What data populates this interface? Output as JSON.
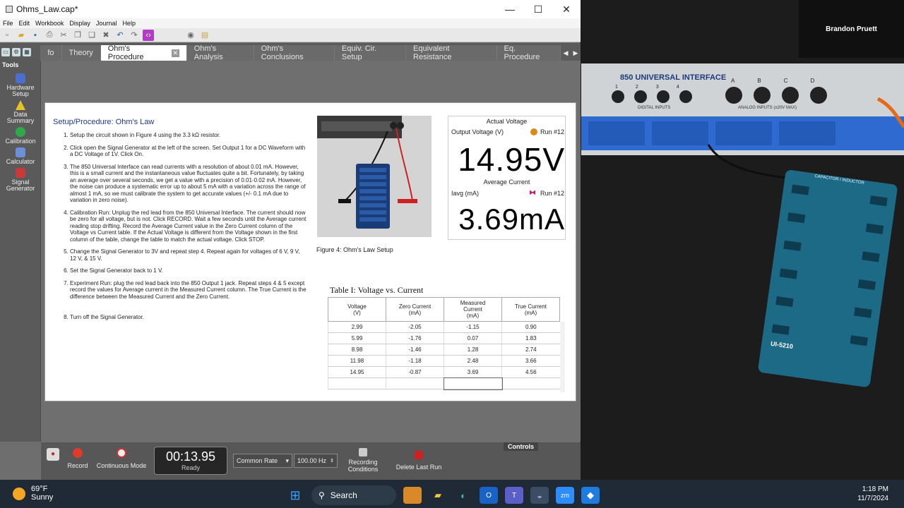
{
  "window": {
    "title": "Ohms_Law.cap*",
    "controls": {
      "minimize": "—",
      "maximize": "☐",
      "close": "✕"
    }
  },
  "menu": [
    "File",
    "Edit",
    "Workbook",
    "Display",
    "Journal",
    "Help"
  ],
  "tabs": [
    {
      "label": "fo",
      "active": false
    },
    {
      "label": "Theory",
      "active": false
    },
    {
      "label": "Ohm's Procedure",
      "active": true
    },
    {
      "label": "Ohm's Analysis",
      "active": false
    },
    {
      "label": "Ohm's Conclusions",
      "active": false
    },
    {
      "label": "Equiv. Cir. Setup",
      "active": false
    },
    {
      "label": "Equivalent Resistance",
      "active": false
    },
    {
      "label": "Eq. Procedure",
      "active": false
    }
  ],
  "tab_close": "✕",
  "tab_nav": {
    "prev": "◀",
    "next": "▶"
  },
  "tools": {
    "header": "Tools",
    "items": [
      {
        "label": "Hardware Setup",
        "icon": "hardware-icon",
        "color": "#4a6fd0"
      },
      {
        "label": "Data Summary",
        "icon": "data-summary-icon",
        "color": "#e6c229"
      },
      {
        "label": "Calibration",
        "icon": "calibration-icon",
        "color": "#2eaa4a"
      },
      {
        "label": "Calculator",
        "icon": "calculator-icon",
        "color": "#6d8fd8"
      },
      {
        "label": "Signal Generator",
        "icon": "signal-generator-icon",
        "color": "#c73a3a"
      }
    ]
  },
  "page": {
    "title": "Setup/Procedure: Ohm's Law",
    "steps": [
      "Setup the circuit shown in Figure 4 using the 3.3 kΩ resistor.",
      "Click open the Signal Generator at the left of the screen.  Set Output 1 for a DC Waveform with a DC Voltage of 1V.  Click On.",
      "The 850 Universal Interface can read currents with a resolution of about 0.01 mA.  However, this is a small current and the instantaneous value fluctuates quite a bit.  Fortunately, by taking an average over several seconds, we get a value with a precision of 0.01-0.02 mA.  However, the noise can produce a systematic error up to about 5 mA with a variation across the range of almost 1 mA, so we must calibrate the system to get accurate values (+/- 0.1 mA due to variation in zero noise).",
      "Calibration Run: Unplug the red lead from the 850 Universal Interface.  The current should now be zero for all voltage, but is not.  Click RECORD.  Wait a few seconds until the Average current reading stop drifting.  Record the Average Current value in the Zero Current column of the Voltage vs Current table.  If the Actual Voltage is different from the Voltage shown in the first column of the table, change the table to match the actual voltage.  Click STOP.",
      "Change the Signal Generator to 3V and repeat step 4.  Repeat again for voltages of 6 V, 9 V, 12 V, & 15 V.",
      "Set the Signal Generator back to 1 V.",
      "Experiment Run: plug the red lead back into the 850 Output 1 jack.  Repeat steps 4 & 5 except record the values for Average current in the Measured Current column.  The True Current is the difference between the Measured Current and the Zero Current.",
      "Turn off the Signal Generator."
    ],
    "figure_caption": "Figure 4: Ohm's Law Setup"
  },
  "meters": {
    "voltage": {
      "heading": "Actual Voltage",
      "label": "Output Voltage (V)",
      "run": "Run #12",
      "value": "14.95V",
      "run_color": "#d98a1e"
    },
    "current": {
      "heading": "Average Current",
      "label": "Iavg (mA)",
      "run": "Run #12",
      "value": "3.69mA",
      "run_color": "#c0187a"
    }
  },
  "table": {
    "title": "Table I: Voltage vs. Current",
    "headers": [
      "Voltage\n(V)",
      "Zero Current\n(mA)",
      "Measured\nCurrent\n(mA)",
      "True Current\n(mA)"
    ],
    "rows": [
      [
        "2.99",
        "-2.05",
        "-1.15",
        "0.90"
      ],
      [
        "5.99",
        "-1.76",
        "0.07",
        "1.83"
      ],
      [
        "8.98",
        "-1.46",
        "1.28",
        "2.74"
      ],
      [
        "11.98",
        "-1.18",
        "2.48",
        "3.66"
      ],
      [
        "14.95",
        "-0.87",
        "3.69",
        "4.56"
      ],
      [
        "",
        "",
        "",
        ""
      ]
    ]
  },
  "controls": {
    "header": "Controls",
    "record": "Record",
    "mode": "Continuous Mode",
    "time": "00:13.95",
    "status": "Ready",
    "rate_mode": "Common Rate",
    "rate": "100.00 Hz",
    "recording_conditions": "Recording Conditions",
    "delete_last_run": "Delete Last Run"
  },
  "camera": {
    "participant": "Brandon Pruett",
    "device_label": "850 UNIVERSAL INTERFACE",
    "digital_inputs": "DIGITAL INPUTS",
    "analog_inputs": "ANALOG INPUTS (±20V MAX)",
    "channels": [
      "A",
      "B",
      "C",
      "D"
    ],
    "digital_channels": [
      "1",
      "2",
      "3",
      "4"
    ],
    "board_label": "UI-5210",
    "board_title": "CAPACITOR / INDUCTOR"
  },
  "taskbar": {
    "temp": "69°F",
    "condition": "Sunny",
    "search": "Search",
    "time": "1:18 PM",
    "date": "11/7/2024",
    "apps": [
      "start-icon",
      "search-icon",
      "files-icon",
      "folder-icon",
      "edge-icon",
      "outlook-icon",
      "teams-icon",
      "capstone-icon",
      "zoom-icon",
      "maps-icon"
    ]
  }
}
